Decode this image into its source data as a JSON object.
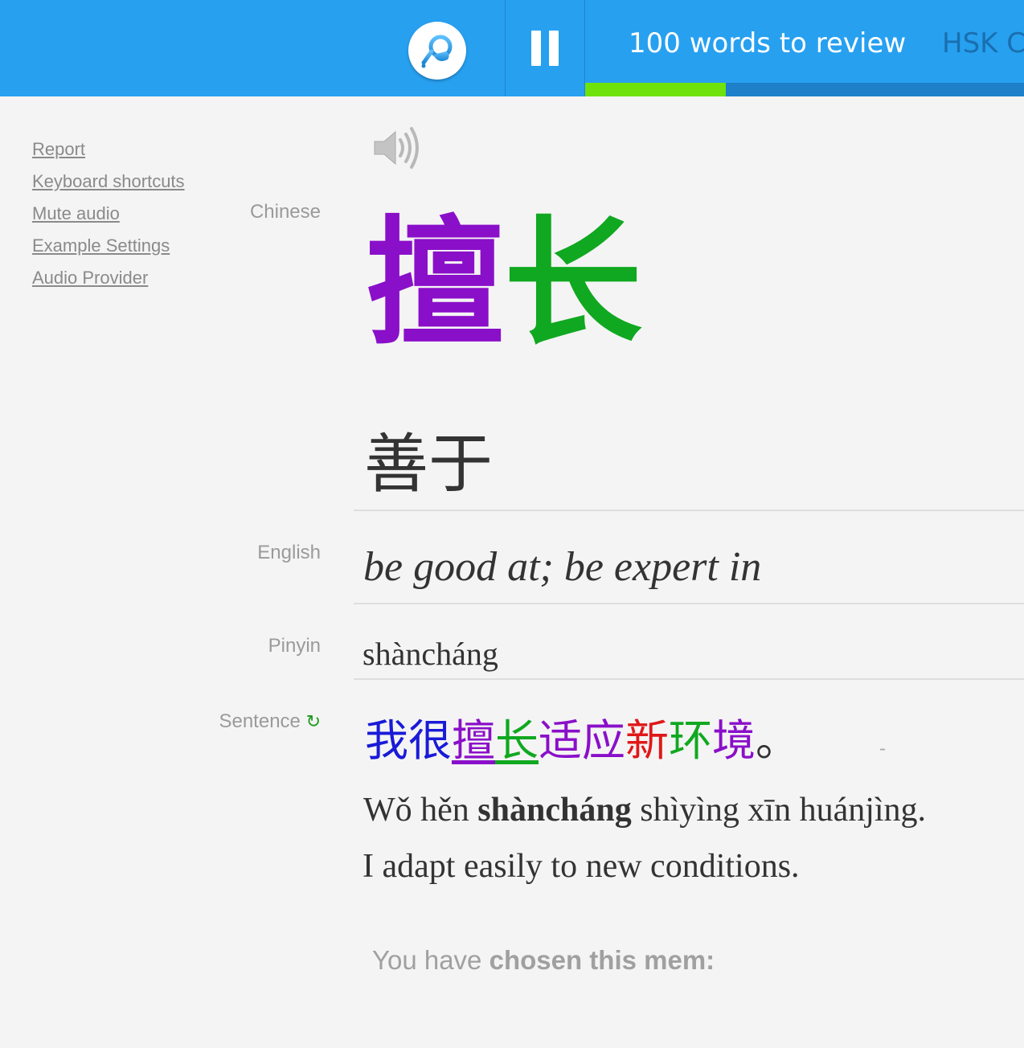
{
  "header": {
    "review_label": "100 words to review",
    "course_label": "HSK C",
    "progress_fraction": 0.32,
    "icons": [
      "watering-can-icon",
      "pause-icon"
    ],
    "colors": {
      "bar": "#27a0f0",
      "progress": "#6fe20c"
    }
  },
  "sidebar": {
    "links": [
      "Report",
      "Keyboard shortcuts",
      "Mute audio",
      "Example Settings",
      "Audio Provider"
    ]
  },
  "labels": {
    "chinese": "Chinese",
    "english": "English",
    "pinyin": "Pinyin",
    "sentence": "Sentence",
    "refresh_glyph": "↻"
  },
  "word": {
    "chars": [
      {
        "char": "擅",
        "color": "#8a0fc9"
      },
      {
        "char": "长",
        "color": "#10a820"
      }
    ],
    "definition_hanzi": "善于",
    "english": "be good at; be expert in",
    "pinyin": "shàncháng",
    "speaker_icon": "speaker-icon"
  },
  "sentence": {
    "chars": [
      {
        "char": "我",
        "color": "#1a1ad8",
        "underline": false
      },
      {
        "char": "很",
        "color": "#1a1ad8",
        "underline": false
      },
      {
        "char": "擅",
        "color": "#8a0fc9",
        "underline": true
      },
      {
        "char": "长",
        "color": "#10a820",
        "underline": true
      },
      {
        "char": "适",
        "color": "#8a0fc9",
        "underline": false
      },
      {
        "char": "应",
        "color": "#8a0fc9",
        "underline": false
      },
      {
        "char": "新",
        "color": "#e01818",
        "underline": false
      },
      {
        "char": "环",
        "color": "#10a820",
        "underline": false
      },
      {
        "char": "境",
        "color": "#8a0fc9",
        "underline": false
      },
      {
        "char": "。",
        "color": "#333333",
        "underline": false
      }
    ],
    "dash": "-",
    "pinyin_before": "Wǒ hěn ",
    "pinyin_bold": "shàncháng",
    "pinyin_after": " shìyìng xīn huánjìng.",
    "translation": "I adapt easily to new conditions."
  },
  "mem": {
    "prefix": "You have ",
    "bold": "chosen this mem:"
  }
}
